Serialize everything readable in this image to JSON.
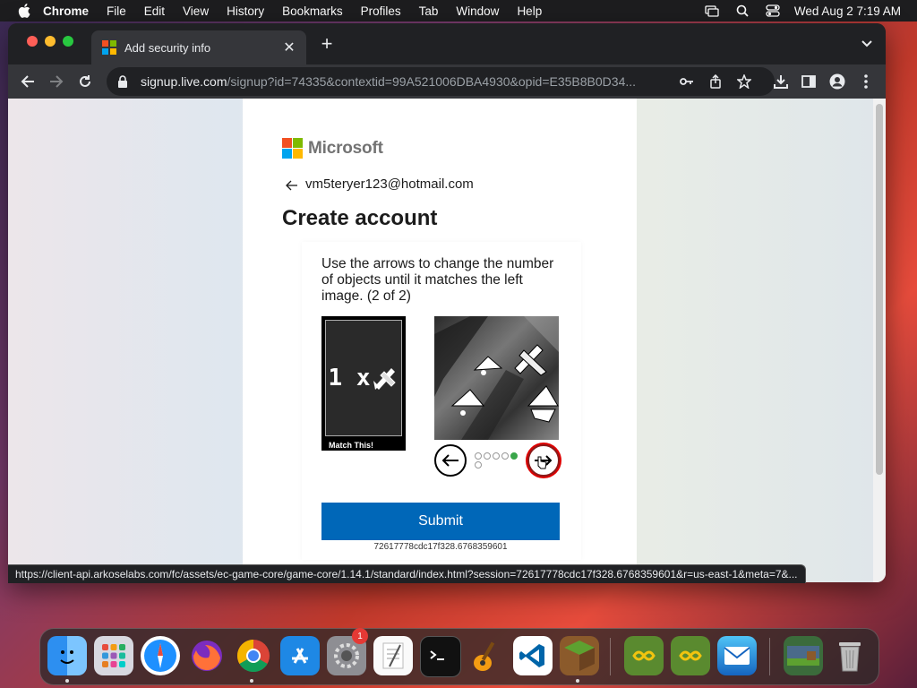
{
  "menubar": {
    "items": [
      "Chrome",
      "File",
      "Edit",
      "View",
      "History",
      "Bookmarks",
      "Profiles",
      "Tab",
      "Window",
      "Help"
    ],
    "clock": "Wed Aug 2  7:19 AM"
  },
  "browser": {
    "tab_title": "Add security info",
    "url_host": "signup.live.com",
    "url_path": "/signup?id=74335&contextid=99A521006DBA4930&opid=E35B8B0D34...",
    "status_url": "https://client-api.arkoselabs.com/fc/assets/ec-game-core/game-core/1.14.1/standard/index.html?session=72617778cdc17f328.6768359601&r=us-east-1&meta=7&..."
  },
  "page": {
    "brand": "Microsoft",
    "email": "vm5teryer123@hotmail.com",
    "title": "Create account",
    "captcha": {
      "instruction": "Use the arrows to change the number of objects until it matches the left image. (2 of 2)",
      "target_count": "1 x",
      "match_label": "Match This!",
      "dots_total": 6,
      "dots_active_index": 4
    },
    "submit_label": "Submit",
    "session_id": "72617778cdc17f328.6768359601"
  },
  "dock": {
    "badge_count": "1",
    "icons": [
      "finder-icon",
      "launchpad-icon",
      "safari-icon",
      "firefox-icon",
      "chrome-icon",
      "app-store-icon",
      "system-settings-icon",
      "textedit-icon",
      "terminal-icon",
      "garageband-icon",
      "vscode-icon",
      "minecraft-icon",
      "minecraft-launcher-icon",
      "minecraft-launcher-2-icon",
      "mail-icon",
      "downloads-stack-icon",
      "trash-icon"
    ]
  },
  "colors": {
    "ms_red": "#f25022",
    "ms_green": "#7fba00",
    "ms_blue": "#00a4ef",
    "ms_yellow": "#ffb900",
    "submit_blue": "#0067b8"
  }
}
